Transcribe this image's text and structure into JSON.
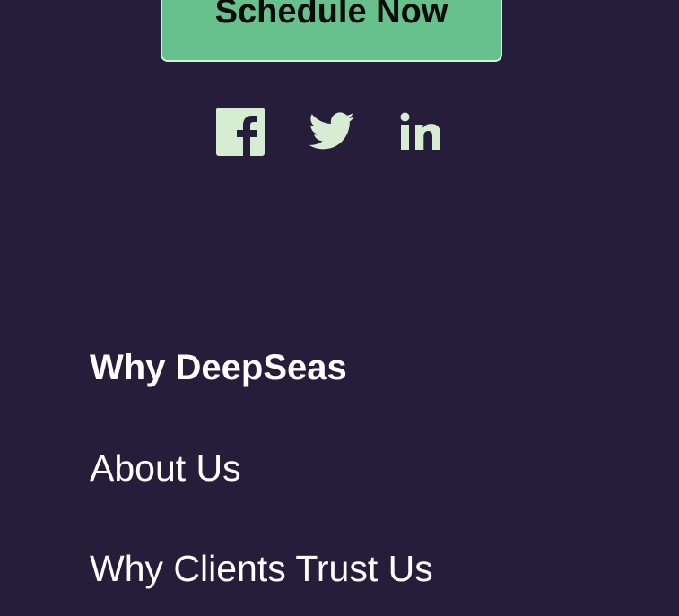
{
  "cta": {
    "label": "Schedule Now"
  },
  "social": [
    {
      "icon": "facebook-icon"
    },
    {
      "icon": "twitter-icon"
    },
    {
      "icon": "linkedin-icon"
    }
  ],
  "footer": {
    "heading": "Why DeepSeas",
    "links": [
      {
        "label": "About Us"
      },
      {
        "label": "Why Clients Trust Us"
      }
    ]
  },
  "colors": {
    "background": "#251d3a",
    "button": "#66c18c",
    "button_border": "#d7eed6",
    "icon": "#d6ecd3",
    "text": "#ffffff"
  }
}
